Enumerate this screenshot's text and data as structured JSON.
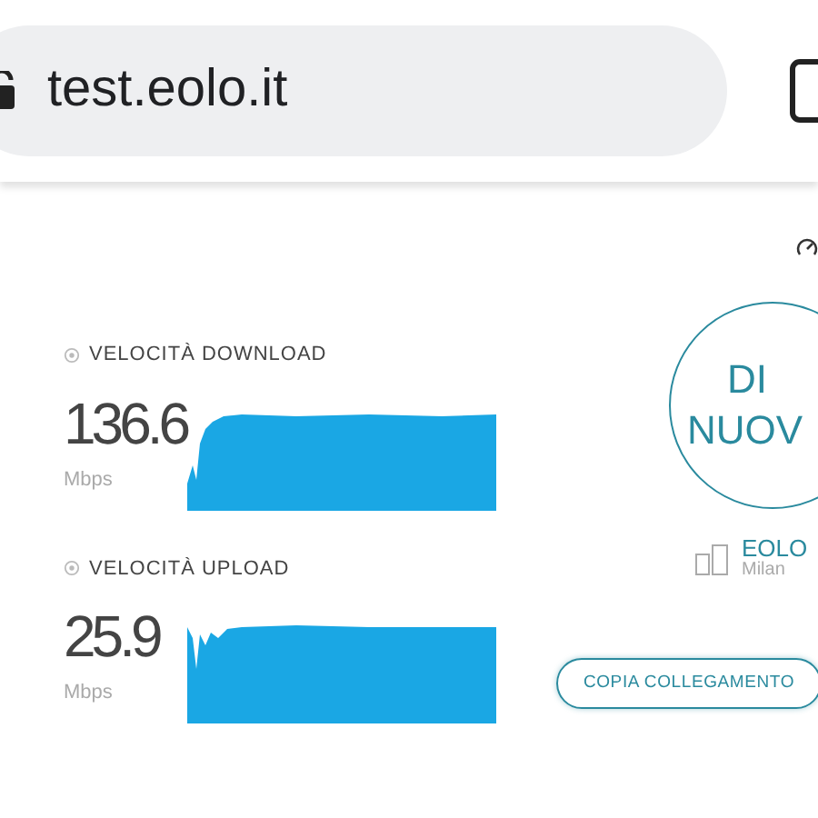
{
  "address_bar": {
    "url": "test.eolo.it"
  },
  "results": [
    {
      "label": "VELOCITÀ DOWNLOAD",
      "value": "136.6",
      "unit": "Mbps",
      "kind": "download"
    },
    {
      "label": "VELOCITÀ UPLOAD",
      "value": "25.9",
      "unit": "Mbps",
      "kind": "upload"
    }
  ],
  "restart_button": {
    "lines": [
      "DI",
      "NUOV"
    ]
  },
  "server": {
    "name": "EOLO",
    "city": "Milan"
  },
  "copy_link_button": {
    "label": "COPIA COLLEGAMENTO"
  }
}
